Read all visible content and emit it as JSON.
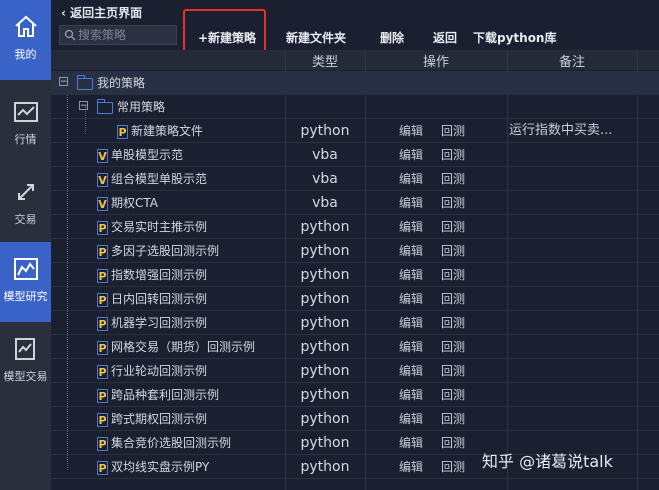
{
  "sidebar": {
    "items": [
      {
        "label": "我的",
        "icon": "home-icon",
        "active": true
      },
      {
        "label": "行情",
        "icon": "chart-icon",
        "active": false
      },
      {
        "label": "交易",
        "icon": "exchange-icon",
        "active": false
      },
      {
        "label": "模型研究",
        "icon": "model-research-icon",
        "active": true
      },
      {
        "label": "模型交易",
        "icon": "model-trade-icon",
        "active": false
      }
    ]
  },
  "topbar": {
    "back_label": "返回主页界面",
    "search_placeholder": "搜索策略",
    "new_strategy": "+新建策略",
    "new_folder": "新建文件夹",
    "delete": "删除",
    "back": "返回",
    "download": "下载python库"
  },
  "table": {
    "headers": {
      "type": "类型",
      "operation": "操作",
      "note": "备注"
    },
    "root_folder": "我的策略",
    "sub_folder": "常用策略",
    "rows": [
      {
        "name": "新建策略文件",
        "badge": "P",
        "type": "python",
        "edit": "编辑",
        "backtest": "回测",
        "note": "运行指数中买卖..."
      },
      {
        "name": "单股模型示范",
        "badge": "V",
        "type": "vba",
        "edit": "编辑",
        "backtest": "回测",
        "note": ""
      },
      {
        "name": "组合模型单股示范",
        "badge": "V",
        "type": "vba",
        "edit": "编辑",
        "backtest": "回测",
        "note": ""
      },
      {
        "name": "期权CTA",
        "badge": "V",
        "type": "vba",
        "edit": "编辑",
        "backtest": "回测",
        "note": ""
      },
      {
        "name": "交易实时主推示例",
        "badge": "P",
        "type": "python",
        "edit": "编辑",
        "backtest": "回测",
        "note": ""
      },
      {
        "name": "多因子选股回测示例",
        "badge": "P",
        "type": "python",
        "edit": "编辑",
        "backtest": "回测",
        "note": ""
      },
      {
        "name": "指数增强回测示例",
        "badge": "P",
        "type": "python",
        "edit": "编辑",
        "backtest": "回测",
        "note": ""
      },
      {
        "name": "日内回转回测示例",
        "badge": "P",
        "type": "python",
        "edit": "编辑",
        "backtest": "回测",
        "note": ""
      },
      {
        "name": "机器学习回测示例",
        "badge": "P",
        "type": "python",
        "edit": "编辑",
        "backtest": "回测",
        "note": ""
      },
      {
        "name": "网格交易（期货）回测示例",
        "badge": "P",
        "type": "python",
        "edit": "编辑",
        "backtest": "回测",
        "note": ""
      },
      {
        "name": "行业轮动回测示例",
        "badge": "P",
        "type": "python",
        "edit": "编辑",
        "backtest": "回测",
        "note": ""
      },
      {
        "name": "跨品种套利回测示例",
        "badge": "P",
        "type": "python",
        "edit": "编辑",
        "backtest": "回测",
        "note": ""
      },
      {
        "name": "跨式期权回测示例",
        "badge": "P",
        "type": "python",
        "edit": "编辑",
        "backtest": "回测",
        "note": ""
      },
      {
        "name": "集合竞价选股回测示例",
        "badge": "P",
        "type": "python",
        "edit": "编辑",
        "backtest": "回测",
        "note": ""
      },
      {
        "name": "双均线实盘示例PY",
        "badge": "P",
        "type": "python",
        "edit": "编辑",
        "backtest": "回测",
        "note": ""
      }
    ]
  },
  "watermark": "知乎 @诸葛说talk",
  "colors": {
    "accent": "#3a63c8",
    "highlight": "#e5322b",
    "badge_text": "#f0c24b"
  }
}
